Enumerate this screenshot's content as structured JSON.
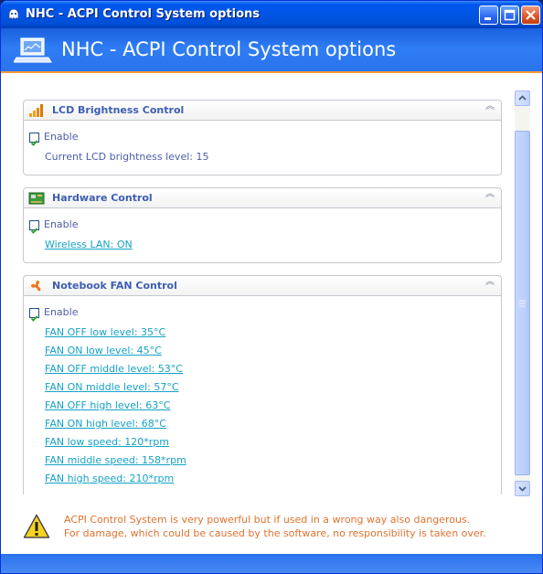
{
  "window": {
    "title": "NHC - ACPI Control System options",
    "header_title": "NHC - ACPI Control System options"
  },
  "groups": {
    "lcd": {
      "title": "LCD Brightness Control",
      "enable_label": "Enable",
      "enabled": true,
      "info": "Current LCD brightness level: 15"
    },
    "hardware": {
      "title": "Hardware Control",
      "enable_label": "Enable",
      "enabled": true,
      "link": "Wireless LAN: ON"
    },
    "fan": {
      "title": "Notebook FAN Control",
      "enable_label": "Enable",
      "enabled": true,
      "links": [
        "FAN OFF low level: 35°C",
        "FAN ON low level: 45°C",
        "FAN OFF middle level: 53°C",
        "FAN ON middle level: 57°C",
        "FAN OFF high level: 63°C",
        "FAN ON high level: 68°C",
        "FAN low speed: 120*rpm",
        "FAN middle speed: 158*rpm",
        "FAN high speed: 210*rpm"
      ]
    }
  },
  "warning": {
    "line1": "ACPI Control System is very powerful but if used in a wrong way also dangerous.",
    "line2": "For damage, which could be caused by the software, no responsibility is taken over."
  },
  "icons": {
    "window": "app-icon",
    "header": "laptop-icon",
    "lcd": "signal-bars-icon",
    "hardware": "hardware-card-icon",
    "fan": "fan-icon",
    "warning": "warning-icon"
  },
  "colors": {
    "titlebar": "#0054e3",
    "header_band": "#2a73ed",
    "accent_rule": "#ff9c3a",
    "group_title": "#3d5eb3",
    "link": "#15a2c4",
    "warning_text": "#e0722f"
  }
}
